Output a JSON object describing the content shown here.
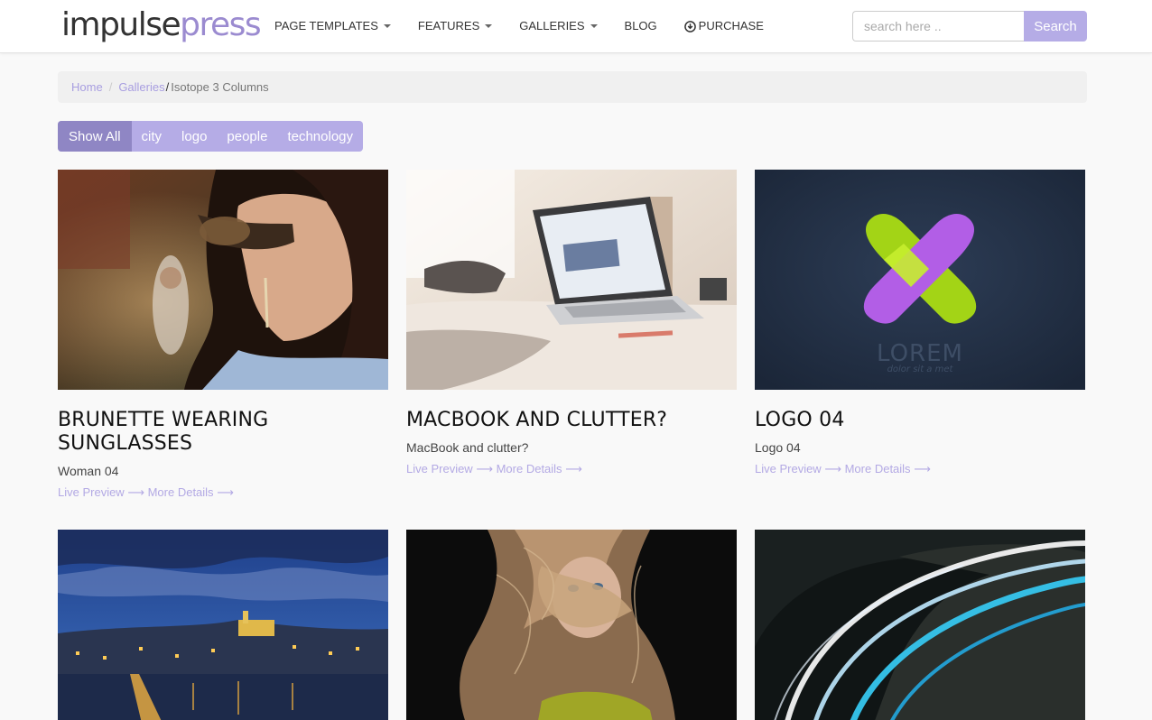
{
  "brand": {
    "part1": "impulse",
    "part2": "press"
  },
  "nav": [
    {
      "label": "PAGE TEMPLATES",
      "has_dropdown": true
    },
    {
      "label": "FEATURES",
      "has_dropdown": true
    },
    {
      "label": "GALLERIES",
      "has_dropdown": true
    },
    {
      "label": "BLOG",
      "has_dropdown": false
    },
    {
      "label": "PURCHASE",
      "has_dropdown": false,
      "icon": "download-circle-icon"
    }
  ],
  "search": {
    "placeholder": "search here ..",
    "value": "",
    "button_label": "Search"
  },
  "breadcrumb": {
    "home": "Home",
    "separator": "/",
    "galleries": "Galleries",
    "separator2": "/",
    "current": "Isotope 3 Columns"
  },
  "filters": [
    {
      "label": "Show All",
      "active": true
    },
    {
      "label": "city",
      "active": false
    },
    {
      "label": "logo",
      "active": false
    },
    {
      "label": "people",
      "active": false
    },
    {
      "label": "technology",
      "active": false
    }
  ],
  "gallery": [
    {
      "title": "BRUNETTE WEARING SUNGLASSES",
      "subtitle": "Woman 04",
      "live_preview": "Live Preview",
      "more_details": "More Details",
      "arrow": "⟶"
    },
    {
      "title": "MACBOOK AND CLUTTER?",
      "subtitle": "MacBook and clutter?",
      "live_preview": "Live Preview",
      "more_details": "More Details",
      "arrow": "⟶"
    },
    {
      "title": "LOGO 04",
      "subtitle": "Logo 04",
      "live_preview": "Live Preview",
      "more_details": "More Details",
      "arrow": "⟶",
      "image_text": {
        "word": "LOREM",
        "tagline": "dolor sit a met"
      }
    },
    {
      "title": "",
      "subtitle": ""
    },
    {
      "title": "",
      "subtitle": ""
    },
    {
      "title": "",
      "subtitle": ""
    }
  ],
  "colors": {
    "accent": "#b5ace6",
    "accent_dark": "#8f86c4",
    "link": "#b3a9e4",
    "brand_purple": "#9b8bd0"
  }
}
